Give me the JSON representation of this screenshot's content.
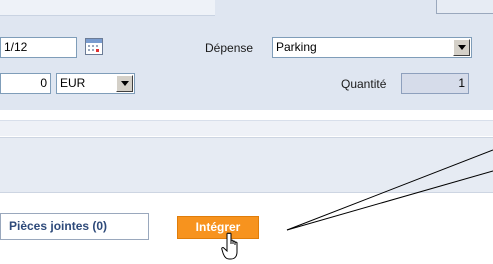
{
  "form": {
    "date_value": "1/12",
    "expense_label": "Dépense",
    "expense_selected": "Parking",
    "amount_value": "0",
    "currency_selected": "EUR",
    "quantity_label": "Quantité",
    "quantity_value": "1"
  },
  "actions": {
    "attachments_label": "Pièces jointes (0)",
    "integrate_label": "Intégrer"
  },
  "icons": {
    "calendar": "calendar-icon",
    "dropdown": "chevron-down-icon",
    "cursor": "hand-pointer-icon"
  },
  "colors": {
    "panel_bg": "#dfe6f1",
    "integrate_button": "#f7931e",
    "attachments_text": "#2e4a7a",
    "input_border": "#7f9db9"
  }
}
